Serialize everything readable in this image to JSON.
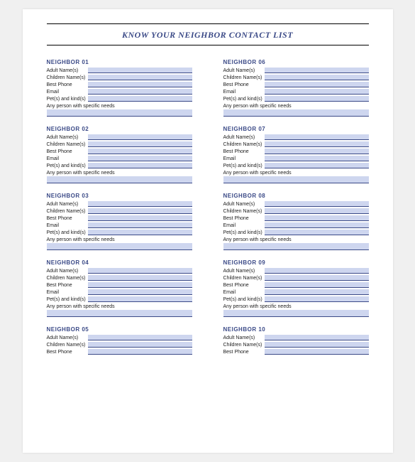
{
  "title": "KNOW YOUR NEIGHBOR CONTACT LIST",
  "fields": {
    "adult": "Adult Name(s)",
    "children": "Children Name(s)",
    "phone": "Best Phone",
    "email": "Email",
    "pets": "Pet(s) and kind(s)",
    "needs": "Any person with specific needs"
  },
  "neighbors_left": [
    {
      "label": "NEIGHBOR 01",
      "rows": [
        "adult",
        "children",
        "phone",
        "email",
        "pets"
      ],
      "needs": true
    },
    {
      "label": "NEIGHBOR 02",
      "rows": [
        "adult",
        "children",
        "phone",
        "email",
        "pets"
      ],
      "needs": true
    },
    {
      "label": "NEIGHBOR 03",
      "rows": [
        "adult",
        "children",
        "phone",
        "email",
        "pets"
      ],
      "needs": true
    },
    {
      "label": "NEIGHBOR 04",
      "rows": [
        "adult",
        "children",
        "phone",
        "email",
        "pets"
      ],
      "needs": true
    },
    {
      "label": "NEIGHBOR 05",
      "rows": [
        "adult",
        "children",
        "phone"
      ],
      "needs": false
    }
  ],
  "neighbors_right": [
    {
      "label": "NEIGHBOR 06",
      "rows": [
        "adult",
        "children",
        "phone",
        "email",
        "pets"
      ],
      "needs": true
    },
    {
      "label": "NEIGHBOR 07",
      "rows": [
        "adult",
        "children",
        "phone",
        "email",
        "pets"
      ],
      "needs": true
    },
    {
      "label": "NEIGHBOR 08",
      "rows": [
        "adult",
        "children",
        "phone",
        "email",
        "pets"
      ],
      "needs": true
    },
    {
      "label": "NEIGHBOR 09",
      "rows": [
        "adult",
        "children",
        "phone",
        "email",
        "pets"
      ],
      "needs": true
    },
    {
      "label": "NEIGHBOR 10",
      "rows": [
        "adult",
        "children",
        "phone"
      ],
      "needs": false
    }
  ]
}
